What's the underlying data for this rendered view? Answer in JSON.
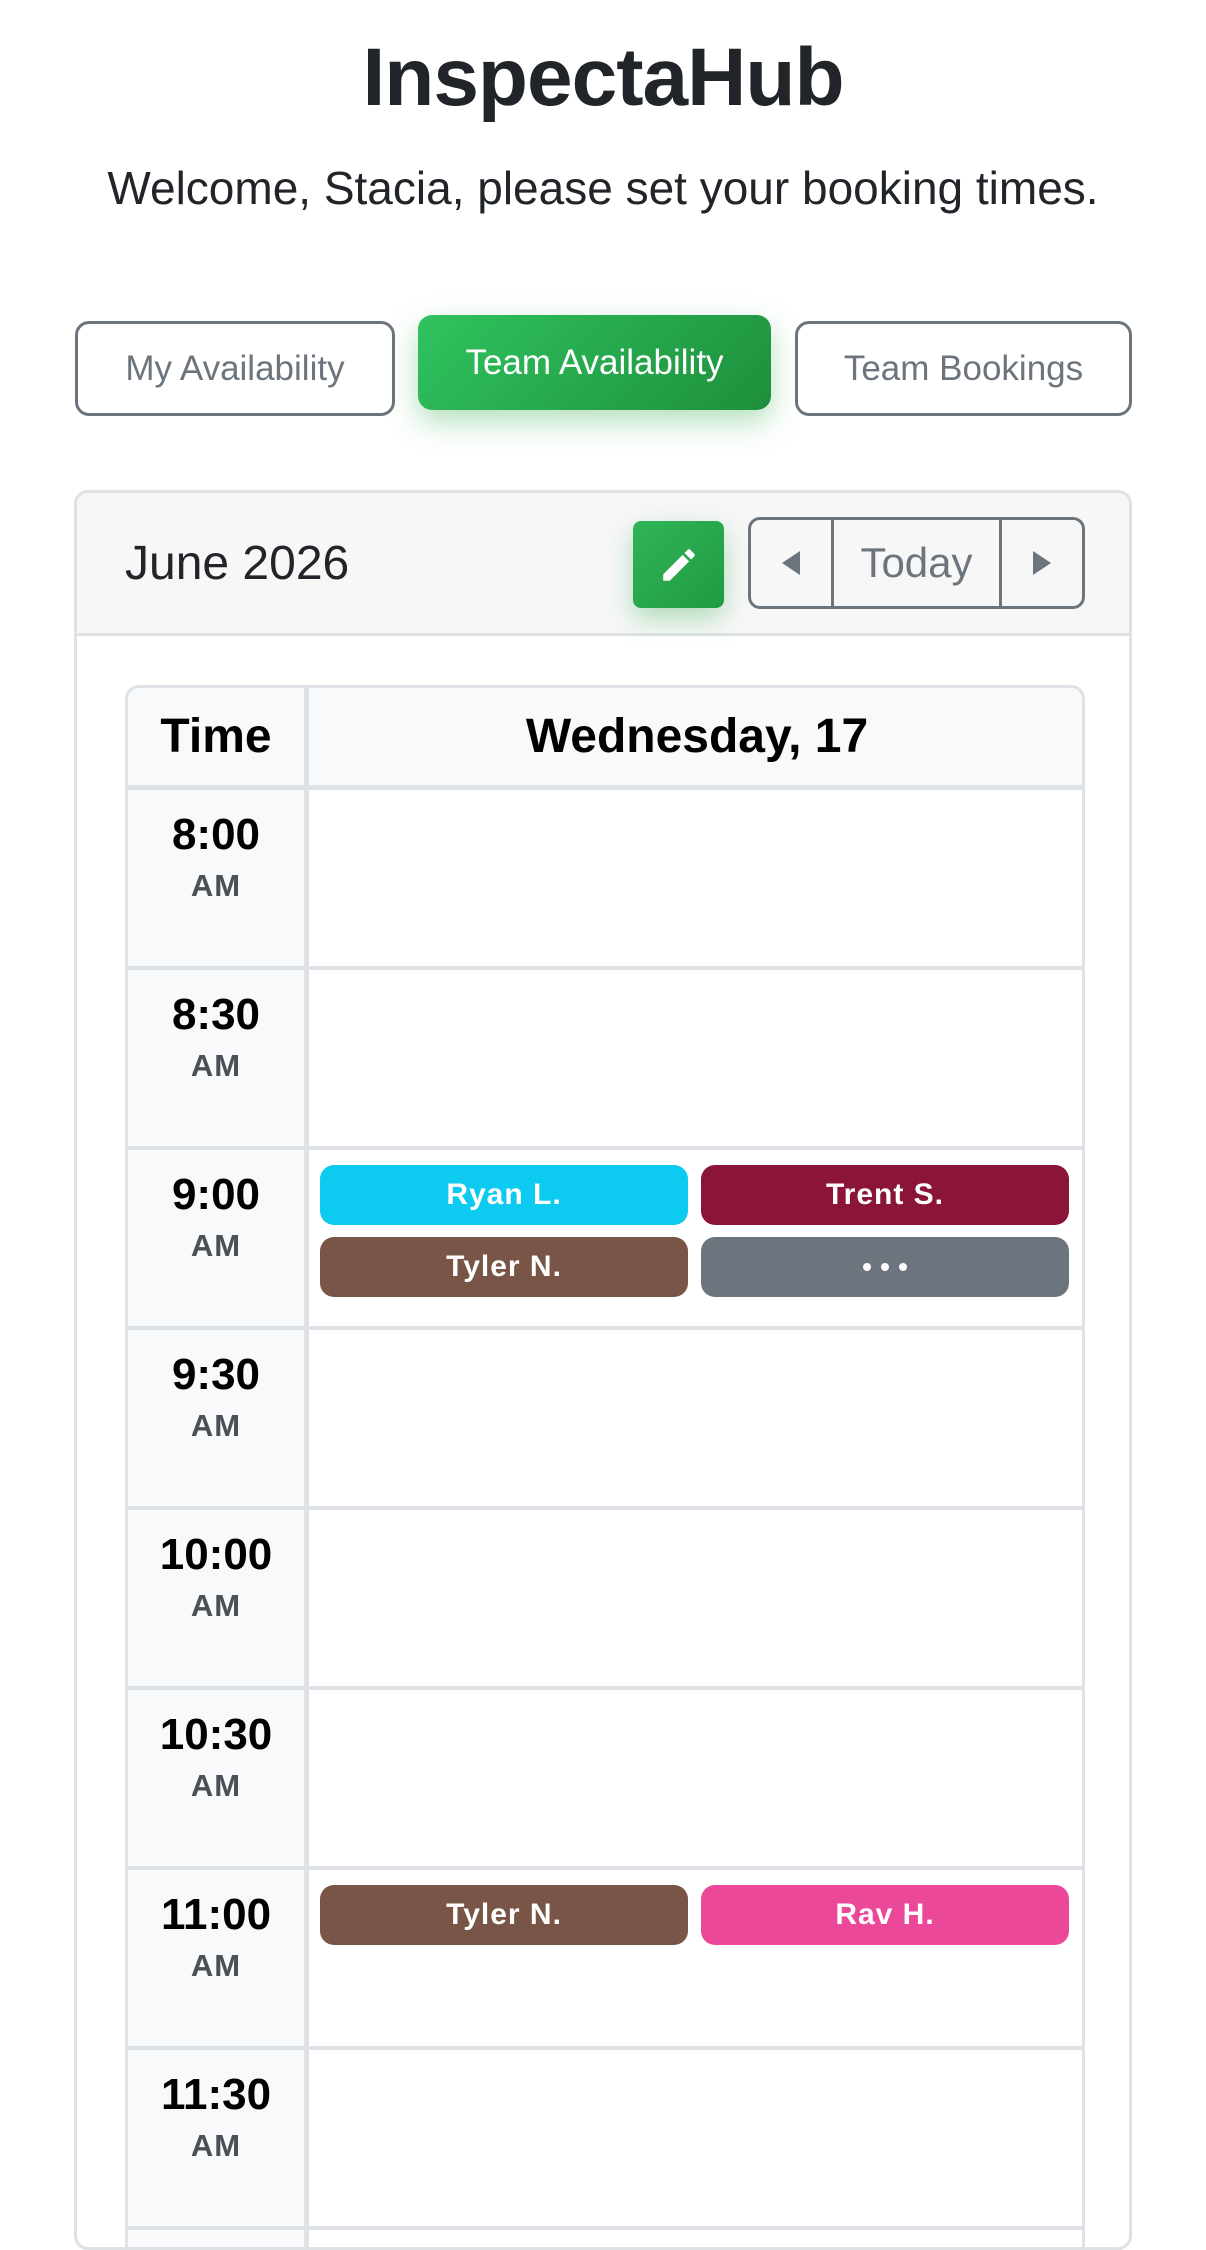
{
  "app": {
    "title": "InspectaHub",
    "welcome": "Welcome, Stacia, please set your booking times."
  },
  "tabs": [
    {
      "label": "My Availability",
      "active": false
    },
    {
      "label": "Team Availability",
      "active": true
    },
    {
      "label": "Team Bookings",
      "active": false
    }
  ],
  "calendar": {
    "month": "June 2026",
    "edit_icon": "pencil-icon",
    "prev_icon": "triangle-left-icon",
    "today_label": "Today",
    "next_icon": "triangle-right-icon",
    "time_header": "Time",
    "day_header": "Wednesday, 17",
    "slots": [
      {
        "time": "8:00",
        "ampm": "AM",
        "entries": []
      },
      {
        "time": "8:30",
        "ampm": "AM",
        "entries": []
      },
      {
        "time": "9:00",
        "ampm": "AM",
        "entries": [
          {
            "name": "Ryan L.",
            "color": "#0dcaf0"
          },
          {
            "name": "Trent S.",
            "color": "#8b1538"
          },
          {
            "name": "Tyler N.",
            "color": "#795548"
          },
          {
            "name": "",
            "color": "#6c757d",
            "icon": "ellipsis-icon"
          }
        ]
      },
      {
        "time": "9:30",
        "ampm": "AM",
        "entries": []
      },
      {
        "time": "10:00",
        "ampm": "AM",
        "entries": []
      },
      {
        "time": "10:30",
        "ampm": "AM",
        "entries": []
      },
      {
        "time": "11:00",
        "ampm": "AM",
        "entries": [
          {
            "name": "Tyler N.",
            "color": "#795548"
          },
          {
            "name": "Rav H.",
            "color": "#ec4899"
          }
        ]
      },
      {
        "time": "11:30",
        "ampm": "AM",
        "entries": []
      }
    ]
  },
  "colors": {
    "accent_green": "#28a745",
    "border_gray": "#dee2e6",
    "muted": "#6c757d"
  }
}
